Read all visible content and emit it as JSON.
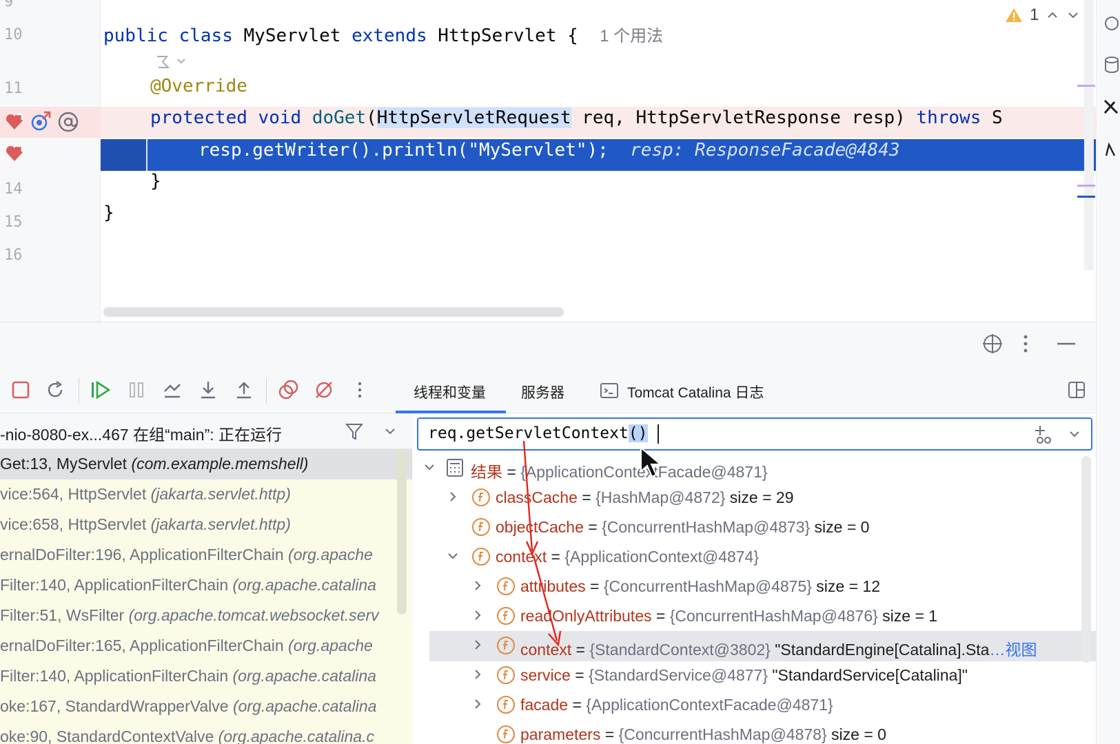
{
  "editor": {
    "line_numbers": [
      "9",
      "10",
      "11",
      "14",
      "15",
      "16"
    ],
    "line10": {
      "kw1": "public",
      "kw2": "class",
      "name": "MyServlet",
      "kw3": "extends",
      "parent": "HttpServlet",
      "brace": "{",
      "usage_hint": "1 个用法"
    },
    "line11": "@Override",
    "line12": {
      "kw1": "protected",
      "kw2": "void",
      "method": "doGet",
      "open": "(",
      "param_type": "HttpServletRequest",
      "rest": " req, HttpServletResponse resp) ",
      "throws": "throws",
      "tail": " S"
    },
    "line13": {
      "code": "resp.getWriter().println(\"MyServlet\");",
      "inline_value": "resp: ResponseFacade@4843"
    },
    "line14": "}",
    "line15": "}",
    "warning_count": "1"
  },
  "panel": {
    "tabs": [
      {
        "label": "线程和变量"
      },
      {
        "label": "服务器"
      },
      {
        "label": "Tomcat Catalina 日志"
      }
    ],
    "thread_text": "-nio-8080-ex...467 在组“main”: 正在运行",
    "frames": [
      {
        "loc": "Get:13, MyServlet ",
        "pkg": "(com.example.memshell)"
      },
      {
        "loc": "vice:564, HttpServlet ",
        "pkg": "(jakarta.servlet.http)"
      },
      {
        "loc": "vice:658, HttpServlet ",
        "pkg": "(jakarta.servlet.http)"
      },
      {
        "loc": "ernalDoFilter:196, ApplicationFilterChain ",
        "pkg": "(org.apache"
      },
      {
        "loc": "Filter:140, ApplicationFilterChain ",
        "pkg": "(org.apache.catalina"
      },
      {
        "loc": "Filter:51, WsFilter ",
        "pkg": "(org.apache.tomcat.websocket.serv"
      },
      {
        "loc": "ernalDoFilter:165, ApplicationFilterChain ",
        "pkg": "(org.apache"
      },
      {
        "loc": "Filter:140, ApplicationFilterChain ",
        "pkg": "(org.apache.catalina"
      },
      {
        "loc": "oke:167, StandardWrapperValve ",
        "pkg": "(org.apache.catalina"
      },
      {
        "loc": "oke:90, StandardContextValve ",
        "pkg": "(org.apache.catalina.c"
      }
    ],
    "eval_expression": "req.getServletContext",
    "eval_selected": "()",
    "tree": [
      {
        "name": "结果",
        "eq": " = ",
        "type": "{ApplicationContextFacade@4871}",
        "extra": ""
      },
      {
        "name": "classCache",
        "eq": " = ",
        "type": "{HashMap@4872}",
        "extra": " size = 29"
      },
      {
        "name": "objectCache",
        "eq": " = ",
        "type": "{ConcurrentHashMap@4873}",
        "extra": " size = 0"
      },
      {
        "name": "context",
        "eq": " = ",
        "type": "{ApplicationContext@4874}",
        "extra": ""
      },
      {
        "name": "attributes",
        "eq": " = ",
        "type": "{ConcurrentHashMap@4875}",
        "extra": " size = 12"
      },
      {
        "name": "readOnlyAttributes",
        "eq": " = ",
        "type": "{ConcurrentHashMap@4876}",
        "extra": " size = 1"
      },
      {
        "name": "context",
        "eq": " = ",
        "type": "{StandardContext@3802}",
        "extra": " \"StandardEngine[Catalina].Sta",
        "link": "…视图"
      },
      {
        "name": "service",
        "eq": " = ",
        "type": "{StandardService@4877}",
        "extra": " \"StandardService[Catalina]\""
      },
      {
        "name": "facade",
        "eq": " = ",
        "type": "{ApplicationContextFacade@4871}",
        "extra": ""
      },
      {
        "name": "parameters",
        "eq": " = ",
        "type": "{ConcurrentHashMap@4878}",
        "extra": " size = 0"
      }
    ]
  },
  "colors": {
    "accent": "#3574f0",
    "breakpoint": "#db5c5c",
    "execution_line": "#2059c5",
    "annotation_arrow": "#e8231c"
  }
}
